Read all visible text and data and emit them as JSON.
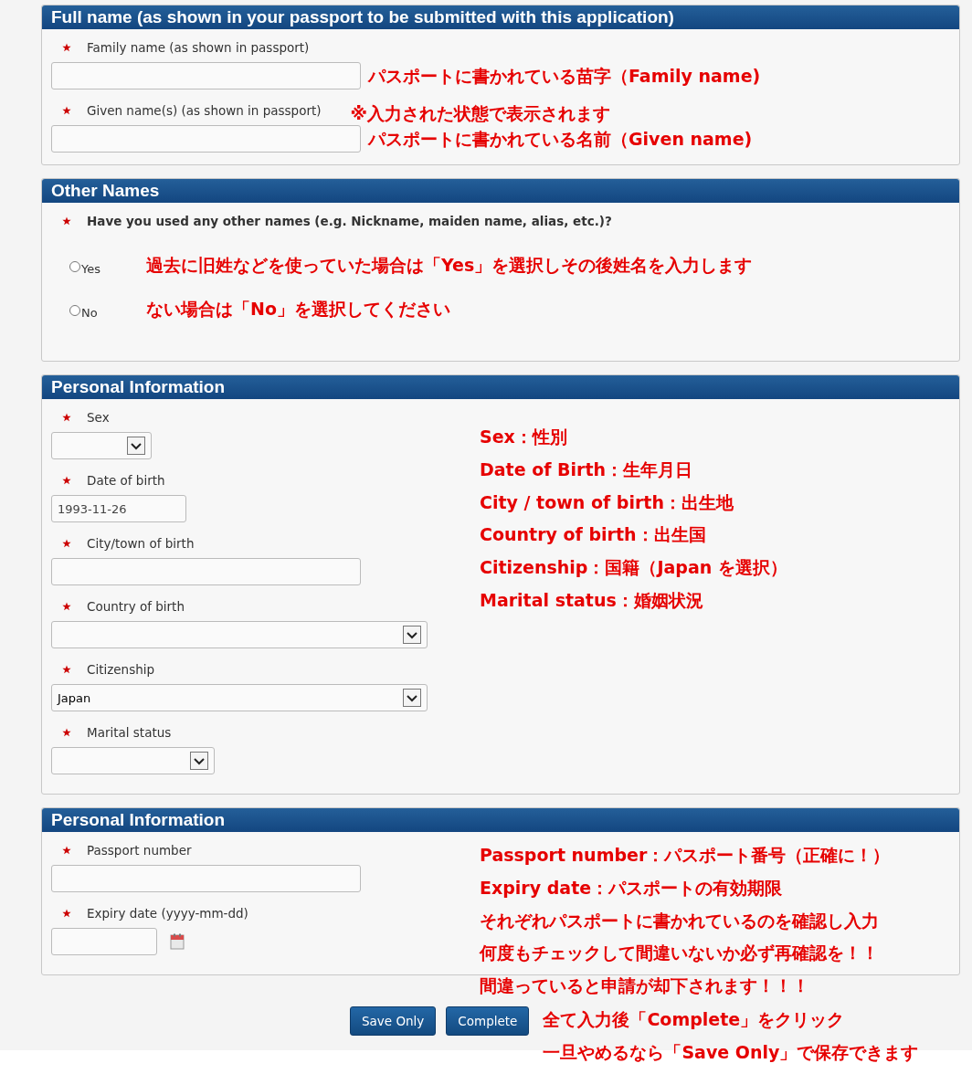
{
  "sections": [
    {
      "title": "Full name (as shown in your passport to be submitted with this application)",
      "fields": [
        {
          "kind": "text",
          "required": true,
          "label": "Family name (as shown in passport)",
          "note": "パスポートに書かれている苗字（Family name)"
        },
        {
          "kind": "text",
          "required": true,
          "label": "Given name(s) (as shown in passport)",
          "label_note": "※入力された状態で表示されます",
          "note": "パスポートに書かれている名前（Given name)"
        }
      ]
    },
    {
      "title": "Other Names",
      "fields": [
        {
          "kind": "radio",
          "required": true,
          "label": "Have you used any other names (e.g. Nickname, maiden name, alias, etc.)?",
          "options": [
            {
              "label": "Yes",
              "selected": false,
              "note": "過去に旧姓などを使っていた場合は「Yes」を選択しその後姓名を入力します"
            },
            {
              "label": "No",
              "selected": false,
              "note": "ない場合は「No」を選択してください"
            }
          ]
        }
      ]
    },
    {
      "title": "Personal Information",
      "fields": [
        {
          "kind": "select",
          "required": true,
          "label": "Sex"
        },
        {
          "kind": "text",
          "required": true,
          "label": "Date of birth",
          "value": "1993-11-26"
        },
        {
          "kind": "text",
          "required": true,
          "label": "City/town of birth"
        },
        {
          "kind": "select",
          "required": true,
          "label": "Country of birth"
        },
        {
          "kind": "select",
          "required": true,
          "label": "Citizenship",
          "value": "Japan"
        },
        {
          "kind": "select",
          "required": true,
          "label": "Marital status"
        }
      ],
      "notes": [
        "Sex：性別",
        "Date of Birth：生年月日",
        "City / town of birth：出生地",
        "Country of birth：出生国",
        "Citizenship：国籍（Japan を選択）",
        "Marital status：婚姻状況"
      ]
    },
    {
      "title": "Personal Information",
      "fields": [
        {
          "kind": "text",
          "required": true,
          "label": "Passport number"
        },
        {
          "kind": "date",
          "required": true,
          "label": "Expiry date (yyyy-mm-dd)"
        }
      ],
      "notes": [
        "Passport number：パスポート番号（正確に！）",
        "Expiry date：パスポートの有効期限",
        "それぞれパスポートに書かれているのを確認し入力",
        "何度もチェックして間違いないか必ず再確認を！！",
        "間違っていると申請が却下されます！！！"
      ]
    }
  ],
  "buttons": [
    {
      "label": "Save Only"
    },
    {
      "label": "Complete"
    }
  ],
  "button_notes": [
    "全て入力後「Complete」をクリック",
    "一旦やめるなら「Save Only」で保存できます"
  ]
}
